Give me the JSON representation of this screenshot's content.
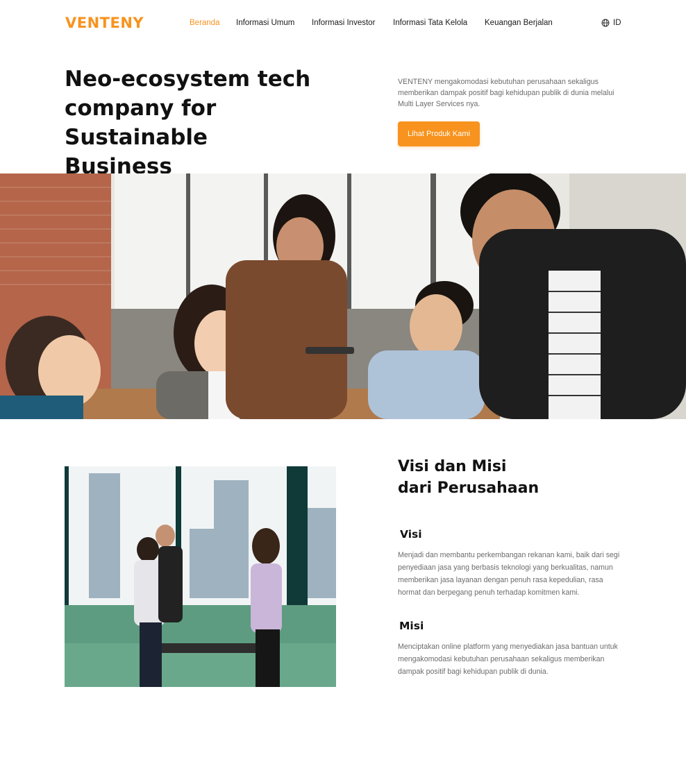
{
  "brand": {
    "logo": "VENTENY",
    "accent": "#f7931e"
  },
  "nav": {
    "items": [
      {
        "label": "Beranda",
        "active": true
      },
      {
        "label": "Informasi Umum",
        "active": false
      },
      {
        "label": "Informasi Investor",
        "active": false
      },
      {
        "label": "Informasi Tata Kelola",
        "active": false
      },
      {
        "label": "Keuangan Berjalan",
        "active": false
      }
    ],
    "language": {
      "icon": "globe-icon",
      "label": "ID"
    }
  },
  "hero": {
    "title_lines": [
      "Neo-ecosystem tech",
      "company for Sustainable",
      "Business"
    ],
    "description": "VENTENY mengakomodasi kebutuhan perusahaan sekaligus memberikan dampak positif bagi kehidupan publik di dunia melalui Multi Layer Services nya.",
    "cta_label": "Lihat Produk Kami"
  },
  "vision": {
    "title_lines": [
      "Visi dan Misi",
      "dari Perusahaan"
    ],
    "visi_heading": "Visi",
    "visi_text": "Menjadi dan membantu perkembangan rekanan kami, baik dari segi penyediaan jasa yang berbasis teknologi yang berkualitas, namun memberikan jasa layanan dengan penuh rasa kepedulian, rasa hormat dan berpegang penuh terhadap komitmen kami.",
    "misi_heading": "Misi",
    "misi_text": "Menciptakan online platform yang menyediakan jasa bantuan untuk mengakomodasi kebutuhan perusahaan sekaligus memberikan dampak positif bagi kehidupan publik di dunia."
  }
}
